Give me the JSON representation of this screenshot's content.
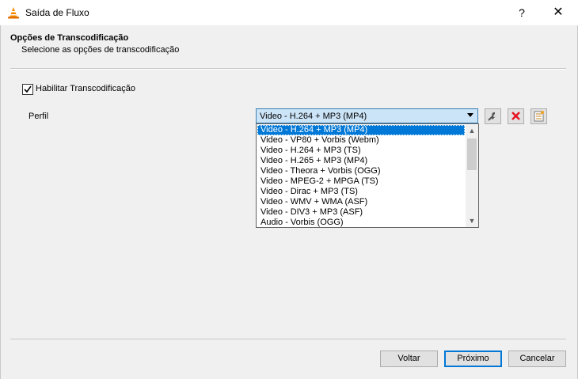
{
  "window": {
    "title": "Saída de Fluxo",
    "help_glyph": "?",
    "close_glyph": "✕",
    "app_icon": "vlc-cone-icon"
  },
  "header": {
    "title": "Opções de Transcodificação",
    "subtitle": "Selecione  as opções de transcodificação"
  },
  "transcode": {
    "enable_label": "Habilitar Transcodificação",
    "enable_checked": true,
    "profile_label": "Perfil",
    "profile_selected": "Video - H.264 + MP3 (MP4)",
    "profile_options": [
      "Video - H.264 + MP3 (MP4)",
      "Video - VP80 + Vorbis (Webm)",
      "Video - H.264 + MP3 (TS)",
      "Video - H.265 + MP3 (MP4)",
      "Video - Theora + Vorbis (OGG)",
      "Video - MPEG-2 + MPGA (TS)",
      "Video - Dirac + MP3 (TS)",
      "Video - WMV + WMA (ASF)",
      "Video - DIV3 + MP3 (ASF)",
      "Audio - Vorbis (OGG)"
    ],
    "tools": [
      "wrench-icon",
      "delete-icon",
      "new-profile-icon"
    ]
  },
  "footer": {
    "back_label": "Voltar",
    "next_label": "Próximo",
    "cancel_label": "Cancelar"
  },
  "colors": {
    "selection": "#0078d7",
    "combo_bg": "#cce4f7",
    "delete_red": "#e81123",
    "vlc_orange": "#f58b00"
  }
}
